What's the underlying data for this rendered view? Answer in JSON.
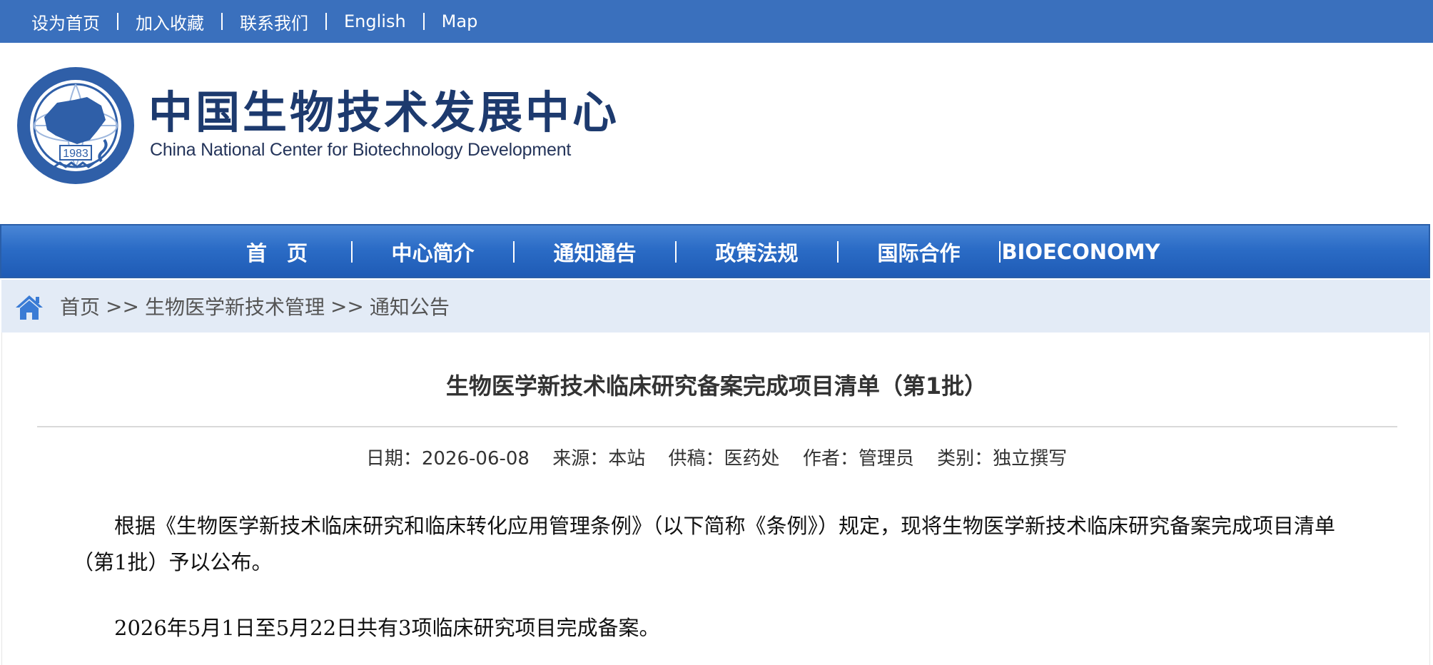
{
  "topbar": {
    "links": [
      "设为首页",
      "加入收藏",
      "联系我们",
      "English",
      "Map"
    ],
    "background": "#3a70bd"
  },
  "header": {
    "seal_year": "1983",
    "name_cn": "中国生物技术发展中心",
    "name_en": "China National Center for Biotechnology Development",
    "brand_color": "#1d3a6e"
  },
  "nav": {
    "items": [
      "首页",
      "中心简介",
      "通知通告",
      "政策法规",
      "国际合作",
      "BIOECONOMY"
    ],
    "background": "#2b6cc6"
  },
  "breadcrumb": {
    "items": [
      "首页",
      "生物医学新技术管理",
      "通知公告"
    ],
    "separator": ">>"
  },
  "article": {
    "title": "生物医学新技术临床研究备案完成项目清单（第1批）",
    "meta": {
      "date_label": "日期：",
      "date": "2026-06-08",
      "source_label": "来源：",
      "source": "本站",
      "contrib_label": "供稿：",
      "contrib": "医药处",
      "author_label": "作者：",
      "author": "管理员",
      "category_label": "类别：",
      "category": "独立撰写"
    },
    "paragraphs": [
      "根据《生物医学新技术临床研究和临床转化应用管理条例》（以下简称《条例》）规定，现将生物医学新技术临床研究备案完成项目清单（第1批）予以公布。",
      "2026年5月1日至5月22日共有3项临床研究项目完成备案。"
    ]
  }
}
